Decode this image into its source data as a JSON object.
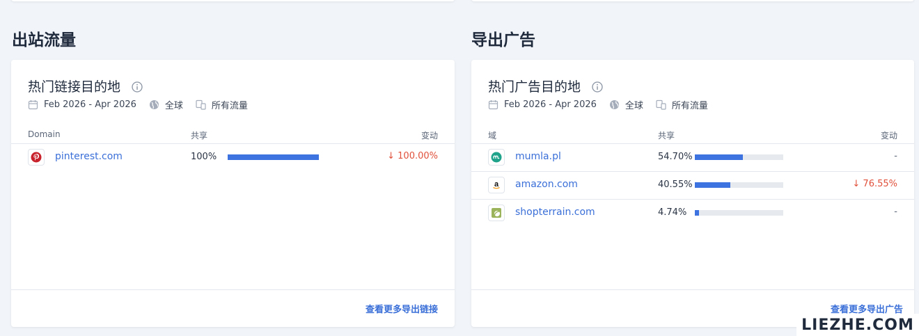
{
  "left_section": {
    "title": "出站流量",
    "card": {
      "title": "热门链接目的地",
      "date_range": "Feb 2026 - Apr 2026",
      "region": "全球",
      "traffic": "所有流量",
      "col_domain": "Domain",
      "col_share": "共享",
      "col_change": "变动",
      "rows": [
        {
          "domain": "pinterest.com",
          "share": "100%",
          "share_pct": 100,
          "change": "↓ 100.00%",
          "icon": "pinterest-logo"
        }
      ],
      "footer_link": "查看更多导出链接"
    }
  },
  "right_section": {
    "title": "导出广告",
    "card": {
      "title": "热门广告目的地",
      "date_range": "Feb 2026 - Apr 2026",
      "region": "全球",
      "traffic": "所有流量",
      "col_domain": "域",
      "col_share": "共享",
      "col_change": "变动",
      "rows": [
        {
          "domain": "mumla.pl",
          "share": "54.70%",
          "share_pct": 54.7,
          "change": "-",
          "icon": "mumla-logo"
        },
        {
          "domain": "amazon.com",
          "share": "40.55%",
          "share_pct": 40.55,
          "change": "↓ 76.55%",
          "icon": "amazon-logo"
        },
        {
          "domain": "shopterrain.com",
          "share": "4.74%",
          "share_pct": 4.74,
          "change": "-",
          "icon": "shopterrain-logo"
        }
      ],
      "footer_link": "查看更多导出广告"
    }
  },
  "watermark": "LIEZHE.COM",
  "colors": {
    "accent": "#3a6fd8",
    "bar": "#3d73e0",
    "negative": "#e0503a"
  }
}
